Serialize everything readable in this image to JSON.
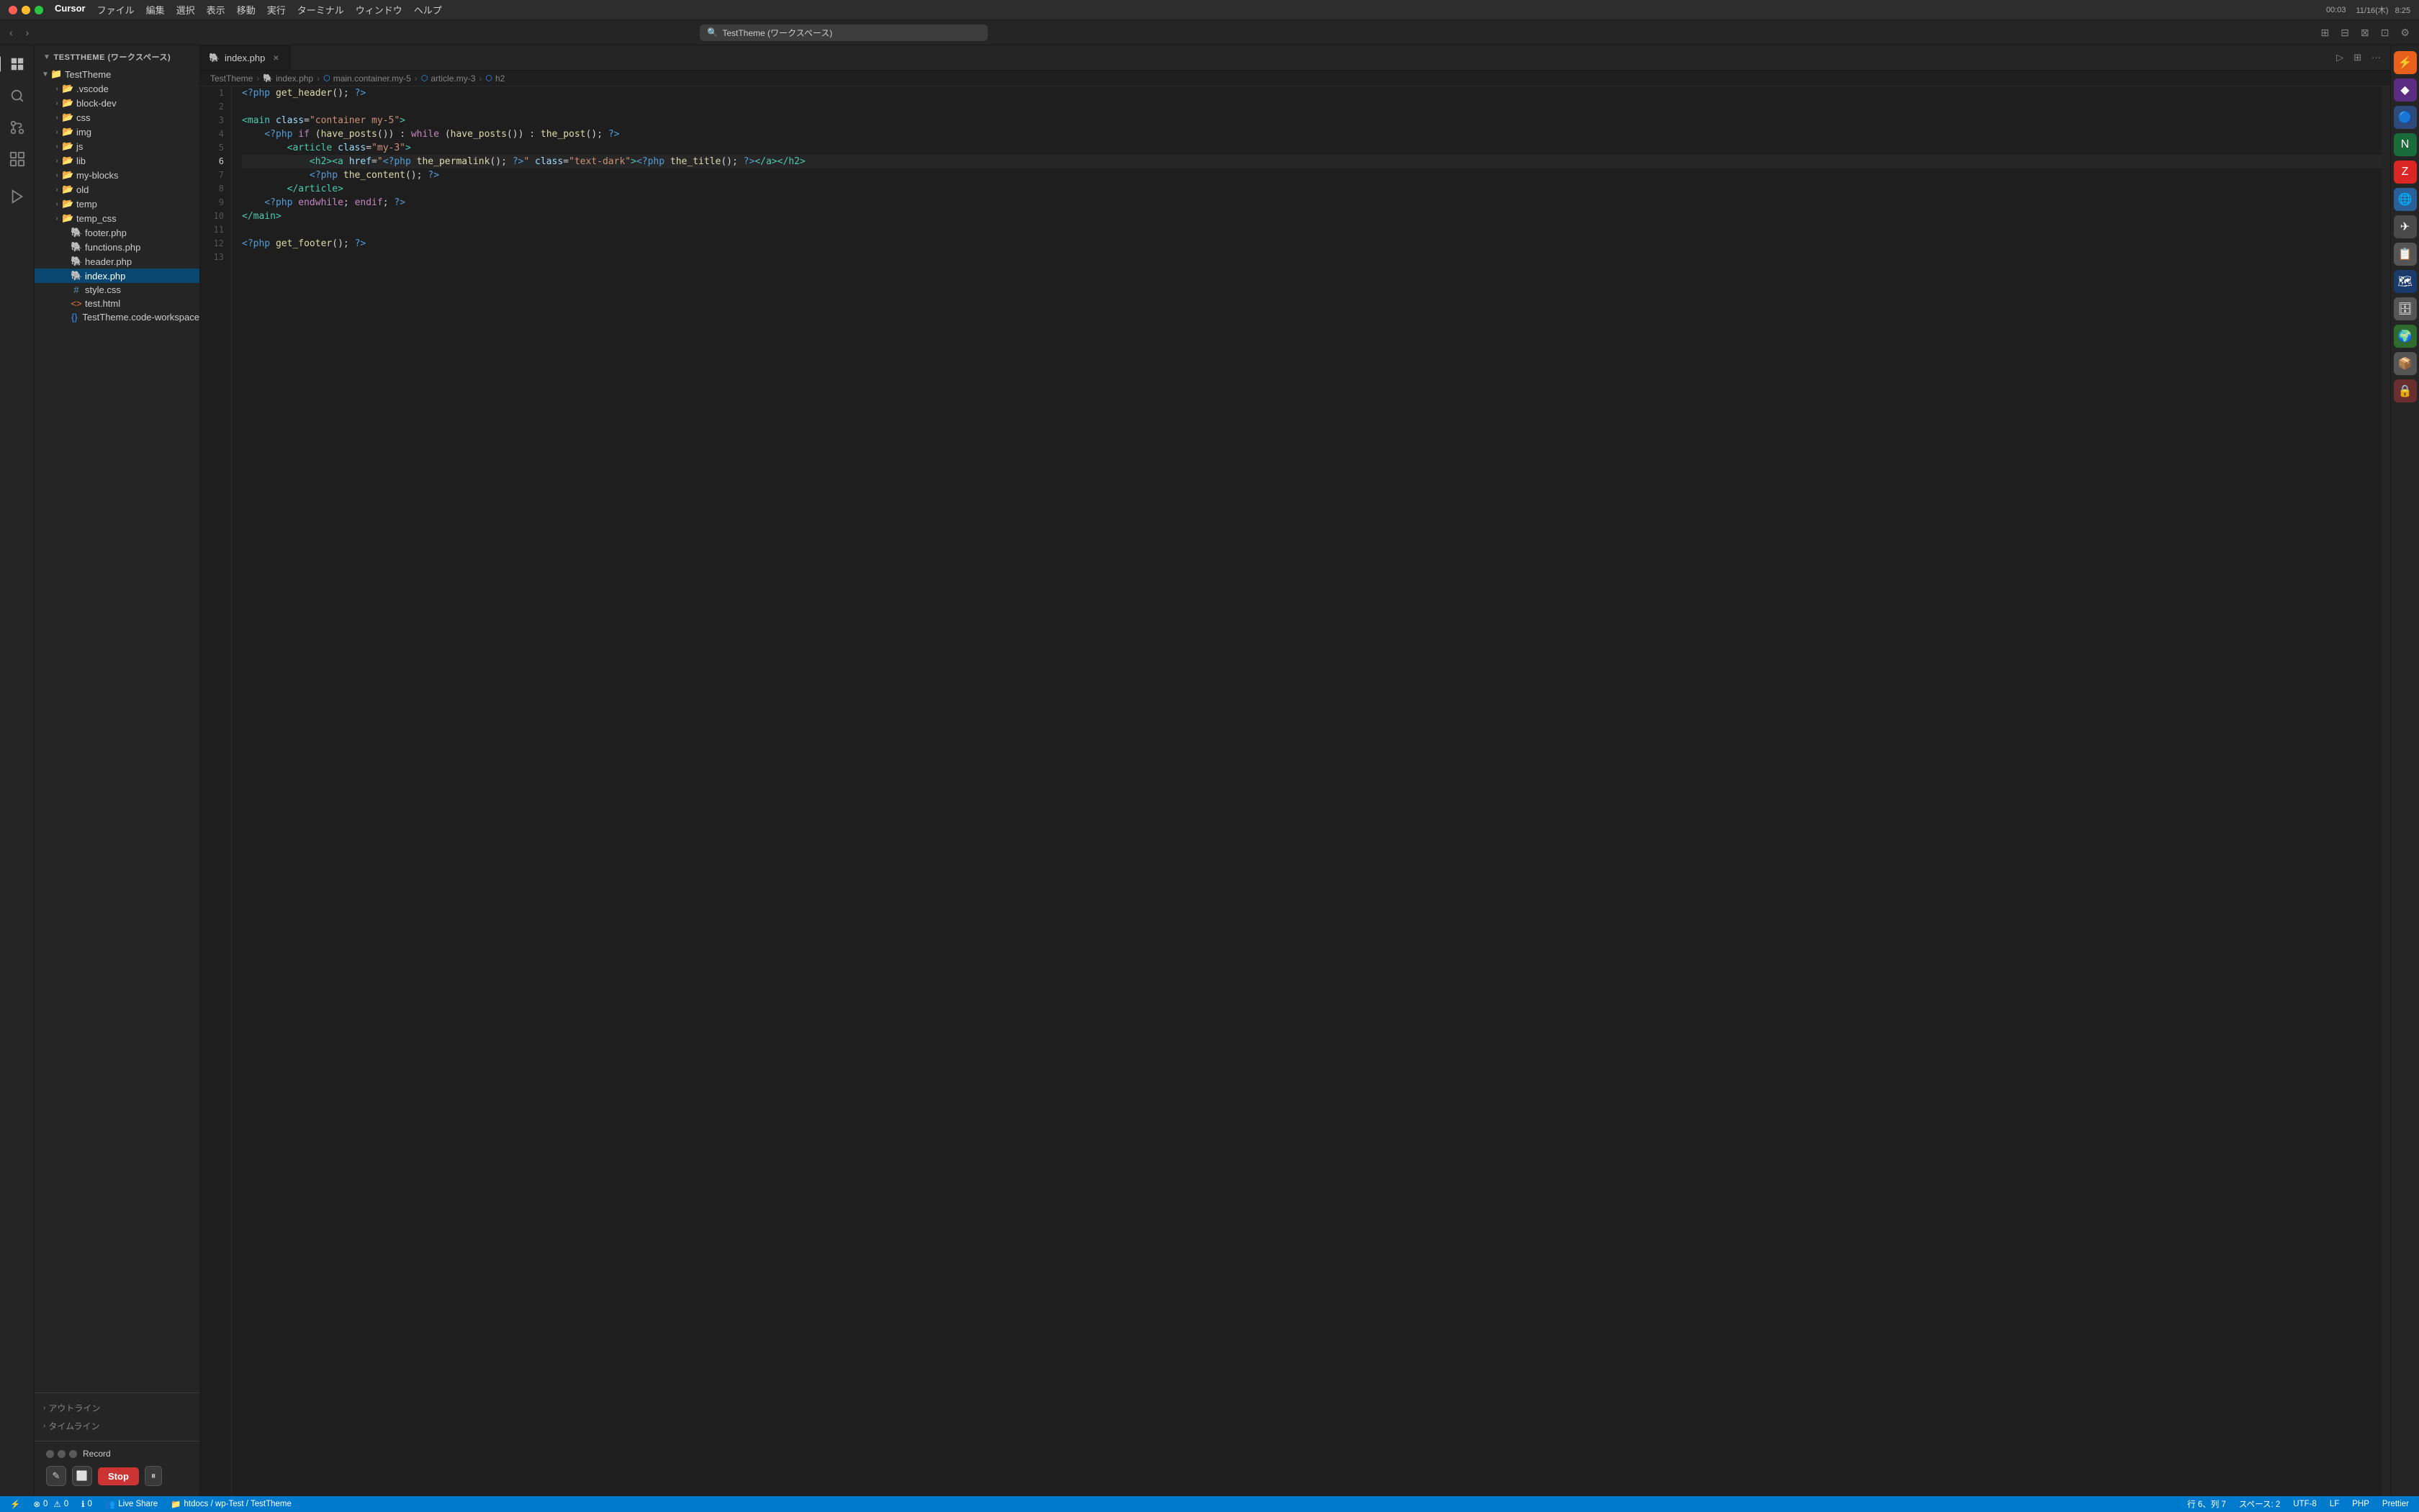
{
  "app": {
    "name": "Cursor",
    "title": "TestTheme (ワークスペース)"
  },
  "menubar": {
    "items": [
      "ファイル",
      "編集",
      "選択",
      "表示",
      "移動",
      "実行",
      "ターミナル",
      "ウィンドウ",
      "ヘルプ"
    ]
  },
  "titlebar": {
    "time": "8:25",
    "date": "11/16(木)",
    "battery": "00:03"
  },
  "tabs": [
    {
      "label": "index.php",
      "active": true,
      "icon": "🐘"
    }
  ],
  "breadcrumb": {
    "items": [
      "TestTheme",
      "index.php",
      "main.container.my-5",
      "article.my-3",
      "h2"
    ],
    "icons": [
      "folder",
      "php",
      "element",
      "element",
      "element"
    ]
  },
  "code": {
    "lines": [
      {
        "num": 1,
        "content": "<?php get_header(); ?>"
      },
      {
        "num": 2,
        "content": ""
      },
      {
        "num": 3,
        "content": "<main class=\"container my-5\">"
      },
      {
        "num": 4,
        "content": "    <?php if (have_posts()) : while (have_posts()) : the_post(); ?>"
      },
      {
        "num": 5,
        "content": "        <article class=\"my-3\">"
      },
      {
        "num": 6,
        "content": "            <h2><a href=\"<?php the_permalink(); ?>\" class=\"text-dark\"><?php the_title(); ?></a></h2>"
      },
      {
        "num": 7,
        "content": "            <?php the_content(); ?>"
      },
      {
        "num": 8,
        "content": "        </article>"
      },
      {
        "num": 9,
        "content": "    <?php endwhile; endif; ?>"
      },
      {
        "num": 10,
        "content": "</main>"
      },
      {
        "num": 11,
        "content": ""
      },
      {
        "num": 12,
        "content": "<?php get_footer(); ?>"
      },
      {
        "num": 13,
        "content": ""
      }
    ]
  },
  "sidebar": {
    "workspace_label": "TESTTHEME (ワークスペース)",
    "root_folder": "TestTheme",
    "items": [
      {
        "name": ".vscode",
        "type": "folder",
        "indent": 2
      },
      {
        "name": "block-dev",
        "type": "folder",
        "indent": 2
      },
      {
        "name": "css",
        "type": "folder",
        "indent": 2
      },
      {
        "name": "img",
        "type": "folder",
        "indent": 2
      },
      {
        "name": "js",
        "type": "folder",
        "indent": 2
      },
      {
        "name": "lib",
        "type": "folder",
        "indent": 2
      },
      {
        "name": "my-blocks",
        "type": "folder",
        "indent": 2
      },
      {
        "name": "old",
        "type": "folder",
        "indent": 2
      },
      {
        "name": "temp",
        "type": "folder",
        "indent": 2
      },
      {
        "name": "temp_css",
        "type": "folder",
        "indent": 2
      },
      {
        "name": "footer.php",
        "type": "php",
        "indent": 2
      },
      {
        "name": "functions.php",
        "type": "php",
        "indent": 2
      },
      {
        "name": "header.php",
        "type": "php",
        "indent": 2
      },
      {
        "name": "index.php",
        "type": "php",
        "indent": 2,
        "active": true
      },
      {
        "name": "style.css",
        "type": "css",
        "indent": 2
      },
      {
        "name": "test.html",
        "type": "html",
        "indent": 2
      },
      {
        "name": "TestTheme.code-workspace",
        "type": "workspace",
        "indent": 2
      }
    ],
    "bottom_sections": [
      "アウトライン",
      "タイムライン"
    ]
  },
  "record": {
    "title": "Record",
    "stop_label": "Stop",
    "pause_icon": "⏸"
  },
  "status_bar": {
    "git_icon": "⚡",
    "errors": "0",
    "warnings": "0",
    "info": "0",
    "live_share": "Live Share",
    "path": "htdocs / wp-Test / TestTheme",
    "position": "行 6、列 7",
    "spaces": "スペース: 2",
    "encoding": "UTF-8",
    "line_ending": "LF",
    "language": "PHP",
    "formatter": "Prettier"
  }
}
